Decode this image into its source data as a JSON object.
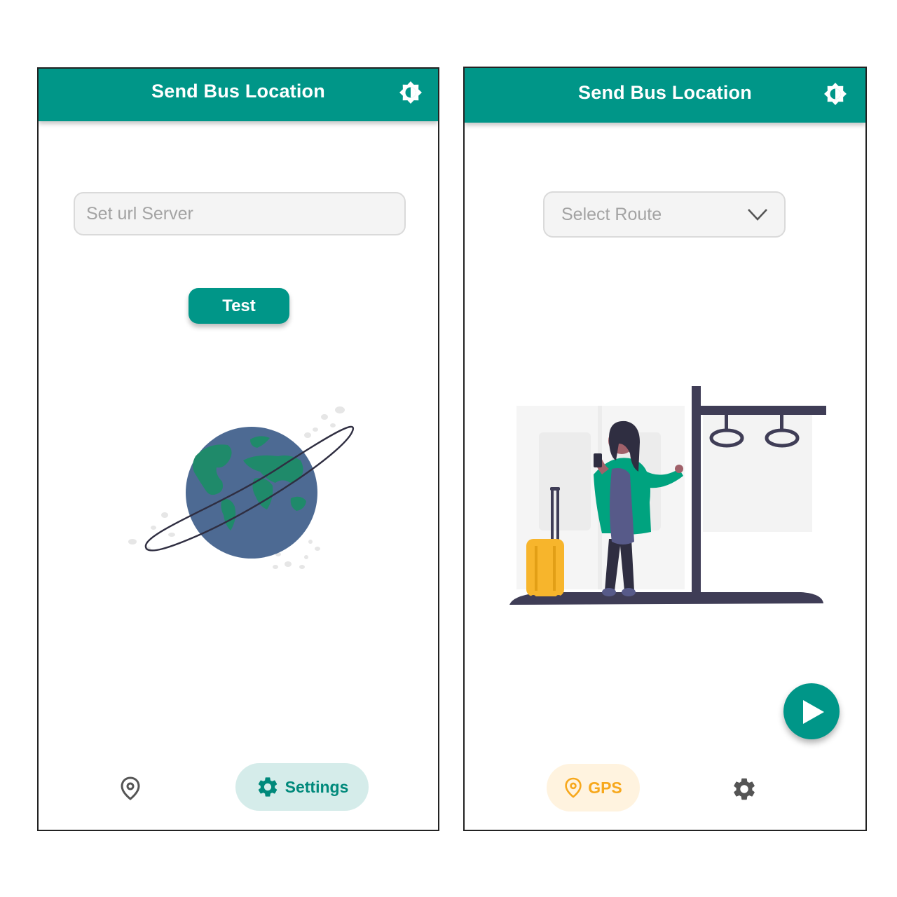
{
  "app": {
    "title": "Send Bus Location",
    "brand_color": "#009688"
  },
  "settings_screen": {
    "url_input": {
      "placeholder": "Set url Server",
      "value": ""
    },
    "test_button_label": "Test",
    "illustration": "globe-with-orbit",
    "nav": {
      "gps_icon": "location-pin-icon",
      "settings_label": "Settings",
      "settings_icon": "gear-icon",
      "active": "settings",
      "active_color": "#00897b",
      "active_bg": "#d5ecea"
    }
  },
  "gps_screen": {
    "route_select": {
      "placeholder": "Select Route",
      "icon": "chevron-down-icon"
    },
    "illustration": "woman-waiting-at-bus-stop",
    "fab_icon": "play-icon",
    "nav": {
      "gps_label": "GPS",
      "gps_icon": "location-pin-icon",
      "settings_icon": "gear-icon",
      "active": "gps",
      "active_color": "#f7a81c",
      "active_bg": "#fff3df"
    }
  }
}
